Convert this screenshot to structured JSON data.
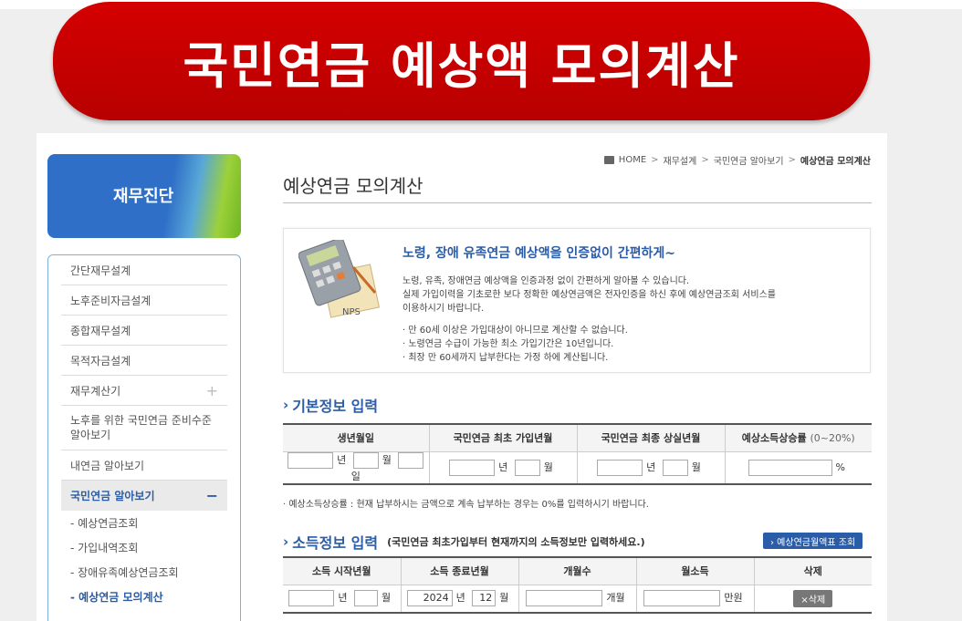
{
  "banner": {
    "title": "국민연금 예상액 모의계산"
  },
  "sidebar": {
    "heading": "재무진단",
    "items": [
      {
        "label": "간단재무설계"
      },
      {
        "label": "노후준비자금설계"
      },
      {
        "label": "종합재무설계"
      },
      {
        "label": "목적자금설계"
      },
      {
        "label": "재무계산기",
        "toggle": "+"
      },
      {
        "label": "노후를 위한 국민연금 준비수준 알아보기"
      },
      {
        "label": "내연금 알아보기"
      },
      {
        "label": "국민연금 알아보기",
        "toggle": "−"
      }
    ],
    "subitems": [
      {
        "label": "- 예상연금조회"
      },
      {
        "label": "- 가입내역조회"
      },
      {
        "label": "- 장애유족예상연금조회"
      },
      {
        "label": "- 예상연금 모의계산"
      }
    ]
  },
  "breadcrumb": {
    "home": "HOME",
    "level1": "재무설계",
    "level2": "국민연금 알아보기",
    "current": "예상연금 모의계산",
    "sep": ">"
  },
  "page": {
    "title": "예상연금 모의계산"
  },
  "info": {
    "heading": "노령, 장애 유족연금 예상액을 인증없이 간편하게~",
    "line1": "노령, 유족, 장애연금 예상액을 인증과정 없이 간편하게 알아볼 수 있습니다.",
    "line2": "실제 가입이력을 기초로한 보다 정확한 예상연금액은 전자인증을 하신 후에 예상연금조회 서비스를",
    "line3": "이용하시기 바랍니다.",
    "bullet1": "· 만 60세 이상은 가입대상이 아니므로 계산할 수 없습니다.",
    "bullet2": "· 노령연금 수급이 가능한 최소 가입기간은 10년입니다.",
    "bullet3": "· 최장 만 60세까지 납부한다는 가정 하에 계산됩니다.",
    "icon_label": "NPS"
  },
  "basic": {
    "heading": "기본정보 입력",
    "headers": [
      "생년월일",
      "국민연금 최초 가입년월",
      "국민연금 최종 상실년월",
      "예상소득상승률"
    ],
    "rate_hint": "(0~20%)",
    "units": {
      "year": "년",
      "month": "월",
      "day": "일",
      "percent": "%"
    },
    "note": "· 예상소득상승률 : 현재 납부하시는 금액으로 계속 납부하는 경우는 0%를 입력하시기 바랍니다."
  },
  "income": {
    "heading": "소득정보 입력",
    "subheading": "(국민연금 최초가입부터 현재까지의 소득정보만 입력하세요.)",
    "table_button": "› 예상연금월액표 조회",
    "headers": [
      "소득 시작년월",
      "소득 종료년월",
      "개월수",
      "월소득",
      "삭제"
    ],
    "end_year": "2024",
    "end_month": "12",
    "units": {
      "year": "년",
      "month": "월",
      "months": "개월",
      "won": "만원"
    },
    "delete_label": "×삭제"
  }
}
